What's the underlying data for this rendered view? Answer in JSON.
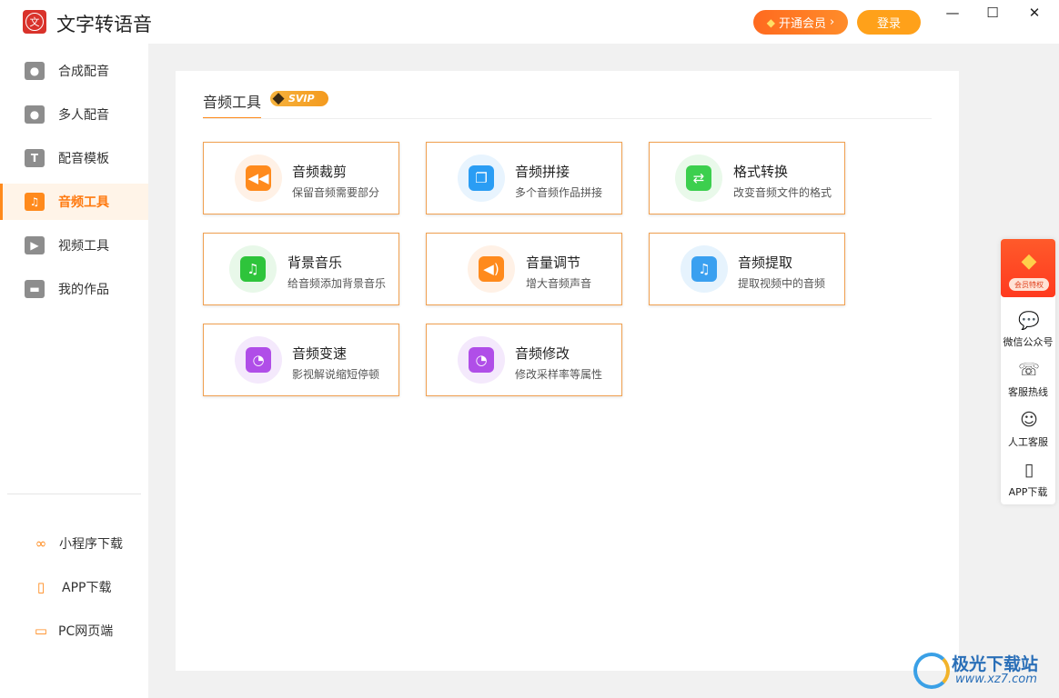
{
  "app": {
    "title": "文字转语音",
    "logo_glyph": "文"
  },
  "header": {
    "vip_label": "开通会员",
    "vip_chevron": "›",
    "login_label": "登录",
    "minimize": "—",
    "maximize": "☐",
    "close": "✕"
  },
  "sidebar": {
    "items": [
      {
        "label": "合成配音",
        "icon": "microphone-icon",
        "glyph": "●"
      },
      {
        "label": "多人配音",
        "icon": "users-icon",
        "glyph": "●"
      },
      {
        "label": "配音模板",
        "icon": "template-icon",
        "glyph": "T"
      },
      {
        "label": "音频工具",
        "icon": "music-note-icon",
        "glyph": "♫",
        "active": true
      },
      {
        "label": "视频工具",
        "icon": "video-icon",
        "glyph": "▶"
      },
      {
        "label": "我的作品",
        "icon": "folder-icon",
        "glyph": "▬"
      }
    ],
    "bottom": [
      {
        "label": "小程序下载",
        "icon": "mini-program-icon",
        "glyph": "∞"
      },
      {
        "label": "APP下载",
        "icon": "phone-icon",
        "glyph": "▯"
      },
      {
        "label": "PC网页端",
        "icon": "monitor-icon",
        "glyph": "▭"
      }
    ]
  },
  "panel": {
    "tab_label": "音频工具",
    "svip_label": "SVIP",
    "tools": [
      {
        "title": "音频裁剪",
        "desc": "保留音频需要部分",
        "icon": "rewind-icon",
        "glyph": "◀◀",
        "color": "#ff8a1c",
        "bg": "#fff1e6"
      },
      {
        "title": "音频拼接",
        "desc": "多个音频作品拼接",
        "icon": "merge-icon",
        "glyph": "❐",
        "color": "#2a9df4",
        "bg": "#e8f4fe"
      },
      {
        "title": "格式转换",
        "desc": "改变音频文件的格式",
        "icon": "convert-icon",
        "glyph": "⇄",
        "color": "#3ccf4e",
        "bg": "#e9f9ea"
      },
      {
        "title": "背景音乐",
        "desc": "给音频添加背景音乐",
        "icon": "music-icon",
        "glyph": "♫",
        "color": "#2ec43b",
        "bg": "#e8f8e9"
      },
      {
        "title": "音量调节",
        "desc": "增大音频声音",
        "icon": "volume-icon",
        "glyph": "◀)",
        "color": "#ff8a1c",
        "bg": "#fff1e6"
      },
      {
        "title": "音频提取",
        "desc": "提取视频中的音频",
        "icon": "extract-audio-icon",
        "glyph": "♫",
        "color": "#3aa0f0",
        "bg": "#e6f3fd"
      },
      {
        "title": "音频变速",
        "desc": "影视解说缩短停顿",
        "icon": "speed-icon",
        "glyph": "◔",
        "color": "#b04ee8",
        "bg": "#f4e9fc"
      },
      {
        "title": "音频修改",
        "desc": "修改采样率等属性",
        "icon": "modify-icon",
        "glyph": "◔",
        "color": "#b04ee8",
        "bg": "#f4e9fc"
      }
    ]
  },
  "float_bar": {
    "vip_tag": "会员特权",
    "items": [
      {
        "label": "微信公众号",
        "icon": "wechat-icon",
        "glyph": "💬"
      },
      {
        "label": "客服热线",
        "icon": "hotline-icon",
        "glyph": "☏"
      },
      {
        "label": "人工客服",
        "icon": "agent-icon",
        "glyph": "☺"
      },
      {
        "label": "APP下载",
        "icon": "phone-icon",
        "glyph": "▯"
      }
    ]
  },
  "watermark": {
    "title": "极光下载站",
    "url": "www.xz7.com"
  }
}
